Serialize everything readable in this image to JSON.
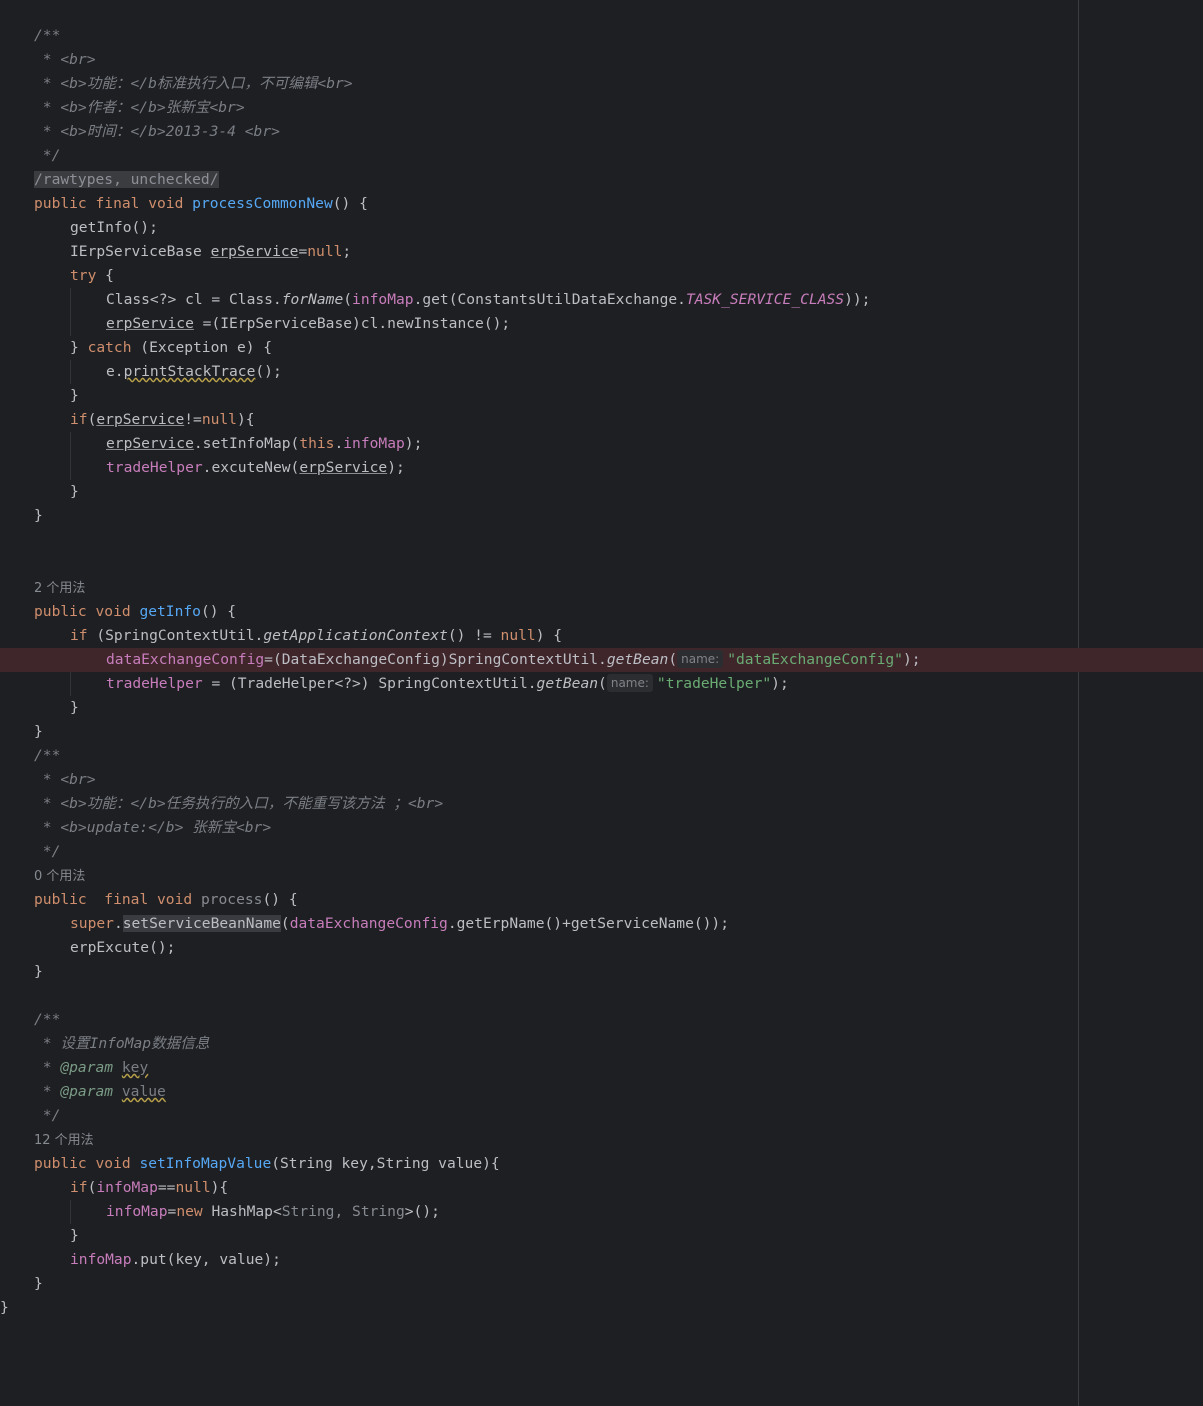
{
  "c1": {
    "l1": "/**",
    "l2": " * <br>",
    "l3a": " * <b>",
    "l3b": "功能：",
    "l3c": "</b",
    "l3d": "标准执行入口，不可编辑",
    "l3e": "<br>",
    "l4a": " * <b>",
    "l4b": "作者：",
    "l4c": "</b>",
    "l4d": "张新宝",
    "l4e": "<br>",
    "l5a": " * <b>",
    "l5b": "时间：",
    "l5c": "</b>",
    "l5d": "2013-3-4 ",
    "l5e": "<br>",
    "l6": " */"
  },
  "annotation": "/rawtypes, unchecked/",
  "m1": {
    "sig_mod": "public final void ",
    "name": "processCommonNew",
    "sig_end": "() {",
    "getinfo_call": "getInfo();",
    "decl_type": "IErpServiceBase ",
    "erp_var": "erpService",
    "decl_eq": "=",
    "null_kw": "null",
    "semi": ";",
    "try_kw": "try",
    "try_brace": " {",
    "cl_decl": "Class<?> cl = Class.",
    "forname": "forName",
    "paren_open": "(",
    "infomap": "infoMap",
    "get_const": ".get(ConstantsUtilDataExchange.",
    "const_name": "TASK_SERVICE_CLASS",
    "close_semi": "));",
    "assign_cast": " =(IErpServiceBase)cl.newInstance();",
    "brace_close": "} ",
    "catch_kw": "catch",
    "catch_rest": " (Exception e) {",
    "e_dot": "e.",
    "pst": "printStackTrace",
    "call_end": "();",
    "rbrace": "}",
    "if_kw": "if",
    "ne": "!=",
    "if_end": "){",
    "setinfo_mid": ".setInfoMap(",
    "this_kw": "this",
    "dot": ".",
    "paren_semi": ");",
    "tradehelper": "tradeHelper",
    "excute_mid": ".excuteNew("
  },
  "usages": {
    "getinfo": "2 个用法",
    "process": "0 个用法",
    "setinfomap": "12 个用法"
  },
  "m2": {
    "sig_mod": "public void ",
    "name": "getInfo",
    "sig_end": "() {",
    "if_kw": "if",
    "if_mid": " (SpringContextUtil.",
    "getappctx": "getApplicationContext",
    "neq": "() != ",
    "null_kw": "null",
    "if_end": ") {",
    "dec_var": "dataExchangeConfig",
    "dec_cast": "=(DataExchangeConfig)SpringContextUtil.",
    "getbean": "getBean",
    "paren_open": "(",
    "hint": "name:",
    "str1": "\"dataExchangeConfig\"",
    "end": ");",
    "th_var": "tradeHelper",
    "th_cast": " = (TradeHelper<?>) SpringContextUtil.",
    "str2": "\"tradeHelper\"",
    "rbrace": "}"
  },
  "c2": {
    "l1": "/**",
    "l2": " * <br>",
    "l3a": " * <b>",
    "l3b": "功能：",
    "l3c": "</b>",
    "l3d": "任务执行的入口，不能重写该方法 ；",
    "l3e": "<br>",
    "l4a": " * <b>",
    "l4b": "update:",
    "l4c": "</b>",
    "l4d": " 张新宝",
    "l4e": "<br>",
    "l5": " */"
  },
  "m3": {
    "public_kw": "public  ",
    "final_kw": "final void ",
    "name": "process",
    "sig_end": "() {",
    "super_kw": "super",
    "dot": ".",
    "setservice": "setServiceBeanName",
    "paren_open": "(",
    "dec_var": "dataExchangeConfig",
    "rest": ".getErpName()+getServiceName());",
    "erpexcute": "erpExcute();",
    "rbrace": "}"
  },
  "c3": {
    "l1": "/**",
    "l2": " * 设置InfoMap数据信息",
    "l3a": " * ",
    "l3b": "@param",
    "l3c": " ",
    "l3d": "key",
    "l4a": " * ",
    "l4b": "@param",
    "l4c": " ",
    "l4d": "value",
    "l5": " */"
  },
  "m4": {
    "sig_mod": "public void ",
    "name": "setInfoMapValue",
    "sig_end": "(String key,String value){",
    "if_kw": "if",
    "paren_open": "(",
    "infomap": "infoMap",
    "eqeq": "==",
    "null_kw": "null",
    "if_end": "){",
    "assign_eq": "=",
    "new_kw": "new",
    "hashmap": " HashMap<",
    "generics": "String, String",
    "hm_end": ">();",
    "rbrace": "}",
    "put": ".put(key, value);"
  },
  "class_close": "}"
}
